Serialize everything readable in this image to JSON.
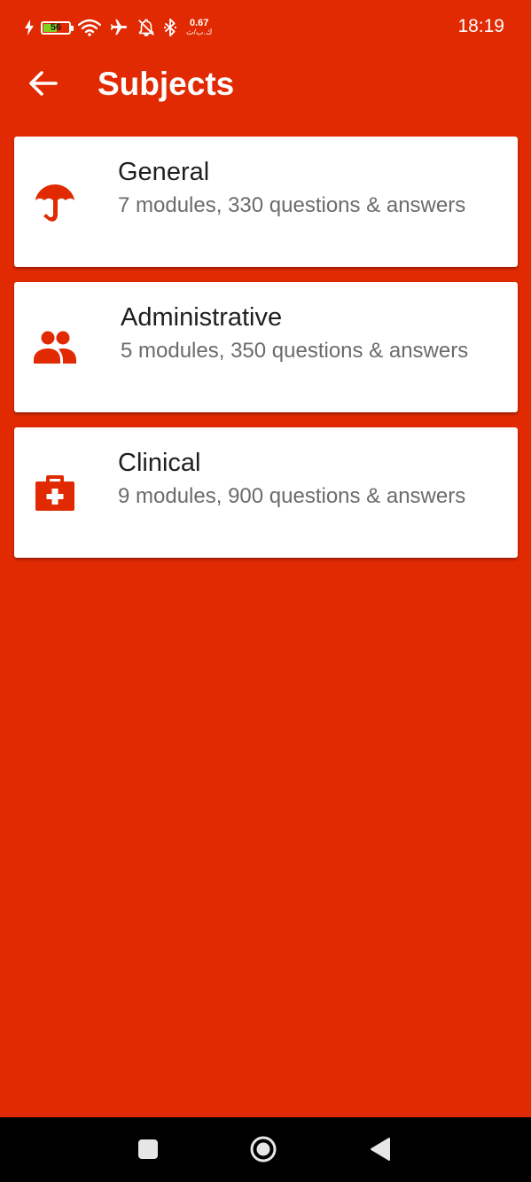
{
  "status_bar": {
    "battery_level": "56",
    "net_speed_value": "0.67",
    "net_speed_unit": "ك.ب/ث",
    "time": "18:19"
  },
  "app_bar": {
    "title": "Subjects",
    "back_icon": "arrow-left-icon"
  },
  "subjects": [
    {
      "icon": "umbrella-icon",
      "title": "General",
      "subtitle": "7 modules, 330 questions & answers"
    },
    {
      "icon": "people-icon",
      "title": "Administrative",
      "subtitle": "5 modules, 350 questions & answers"
    },
    {
      "icon": "medical-kit-icon",
      "title": "Clinical",
      "subtitle": "9 modules, 900 questions & answers"
    }
  ],
  "nav_bar": {
    "recents_icon": "square-icon",
    "home_icon": "circle-icon",
    "back_icon": "triangle-back-icon"
  },
  "colors": {
    "accent": "#E12A02",
    "battery_fill": "#7ED321",
    "card_bg": "#FFFFFF",
    "nav_bg": "#000000"
  }
}
